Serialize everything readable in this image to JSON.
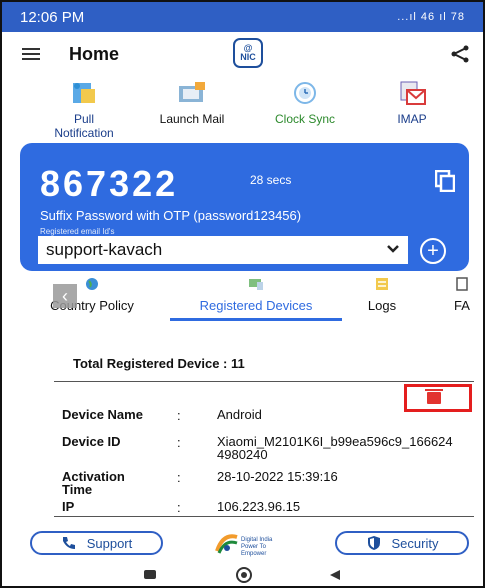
{
  "status_bar": {
    "time": "12:06 PM",
    "indicators": "...ıl 46 ıl 78"
  },
  "header": {
    "title": "Home",
    "logo_text_top": "@",
    "logo_text_bottom": "NIC"
  },
  "quick_actions": [
    {
      "label_line1": "Pull",
      "label_line2": "Notification",
      "icon": "pull-notification-icon"
    },
    {
      "label_line1": "Launch Mail",
      "label_line2": "",
      "icon": "launch-mail-icon"
    },
    {
      "label_line1": "Clock Sync",
      "label_line2": "",
      "icon": "clock-sync-icon"
    },
    {
      "label_line1": "IMAP",
      "label_line2": "",
      "icon": "imap-icon"
    }
  ],
  "otp_card": {
    "otp": "867322",
    "timer": "28 secs",
    "suffix_text": "Suffix Password with OTP (password123456)",
    "registered_label": "Registered email Id's",
    "selected_email": "support-kavach",
    "card_color": "#2f6be0"
  },
  "tabs": [
    {
      "label": "Country Policy",
      "active": false
    },
    {
      "label": "Registered Devices",
      "active": true
    },
    {
      "label": "Logs",
      "active": false
    },
    {
      "label": "FA",
      "active": false
    }
  ],
  "devices": {
    "total_text": "Total Registered Device : 11",
    "rows": [
      {
        "key": "Device Name",
        "sep": ":",
        "value": "Android"
      },
      {
        "key": "Device ID",
        "sep": ":",
        "value": "Xiaomi_M2101K6I_b99ea596c9_1666244980240"
      },
      {
        "key": "Activation Time",
        "sep": ":",
        "value": "28-10-2022 15:39:16"
      },
      {
        "key": "IP",
        "sep": ":",
        "value": "106.223.96.15"
      }
    ]
  },
  "footer": {
    "support_label": "Support",
    "security_label": "Security",
    "digital_india_line1": "Digital India",
    "digital_india_line2": "Power To Empower"
  },
  "colors": {
    "accent": "#2f6be0",
    "status_bar": "#2f5fc4",
    "delete_highlight": "#e41e1e"
  }
}
